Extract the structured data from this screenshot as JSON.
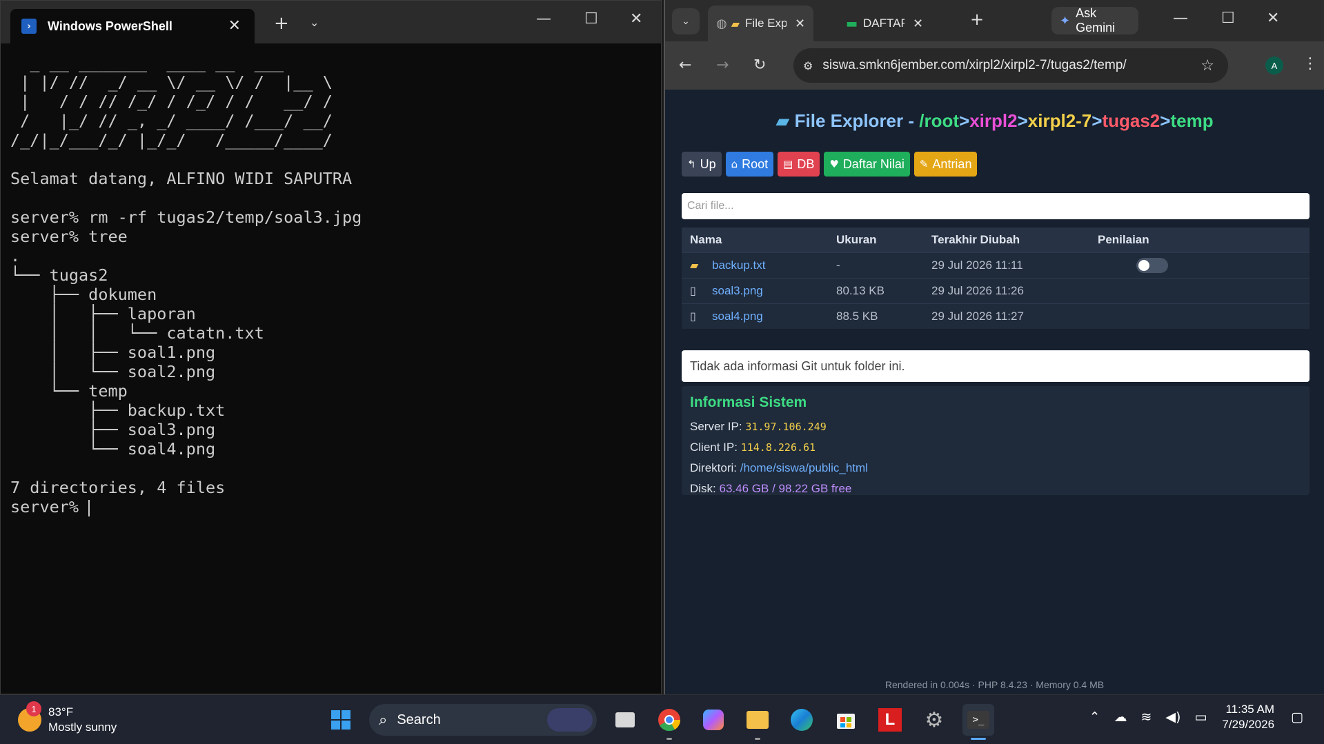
{
  "powershell": {
    "tab_title": "Windows PowerShell",
    "tab_icon": "powershell-icon",
    "terminal_lines": [
      "  _ __ _______  ____ __  ___",
      " | |/ //  _/ __ \\/ __ \\/ /  |__ \\",
      " |   / / // /_/ / /_/ / /   __/ /",
      " /   |_/ // _, _/ ____/ /___/ __/",
      "/_/|_/___/_/ |_/_/   /_____/____/",
      "",
      "Selamat datang, ALFINO WIDI SAPUTRA",
      "",
      "server% rm -rf tugas2/temp/soal3.jpg",
      "server% tree",
      ".",
      "└── tugas2",
      "    ├── dokumen",
      "    │   ├── laporan",
      "    │   │   └── catatn.txt",
      "    │   ├── soal1.png",
      "    │   └── soal2.png",
      "    └── temp",
      "        ├── backup.txt",
      "        ├── soal3.png",
      "        └── soal4.png",
      "",
      "7 directories, 4 files"
    ],
    "prompt": "server% "
  },
  "chrome": {
    "tabs": [
      {
        "label": "File Explorer",
        "icon": "folder-icon"
      },
      {
        "label": "DAFTAR HADIR",
        "icon": "sheets-icon"
      }
    ],
    "gemini_label": "Ask Gemini",
    "url": "siswa.smkn6jember.com/xirpl2/xirpl2-7/tugas2/temp/",
    "avatar_letter": "A"
  },
  "explorer": {
    "title_label": "File Explorer -",
    "path": [
      {
        "text": "/root",
        "color": "#3ddc84"
      },
      {
        "text": ">",
        "color": "#8ec5ff"
      },
      {
        "text": "xirpl2",
        "color": "#e94fd6"
      },
      {
        "text": ">",
        "color": "#8ec5ff"
      },
      {
        "text": "xirpl2-7",
        "color": "#f4d14a"
      },
      {
        "text": ">",
        "color": "#8ec5ff"
      },
      {
        "text": "tugas2",
        "color": "#ff5a6a"
      },
      {
        "text": ">",
        "color": "#8ec5ff"
      },
      {
        "text": "temp",
        "color": "#3ddc84"
      }
    ],
    "buttons": [
      {
        "label": "Up",
        "icon": "↰",
        "color": "#3a4456"
      },
      {
        "label": "Root",
        "icon": "⌂",
        "color": "#2f7be0"
      },
      {
        "label": "DB",
        "icon": "▤",
        "color": "#e0424f"
      },
      {
        "label": "Daftar Nilai",
        "icon": "♥",
        "color": "#1fae5b"
      },
      {
        "label": "Antrian",
        "icon": "✎",
        "color": "#e5a615"
      }
    ],
    "search_placeholder": "Cari file...",
    "columns": [
      "Nama",
      "Ukuran",
      "Terakhir Diubah",
      "Penilaian"
    ],
    "rows": [
      {
        "name": "backup.txt",
        "size": "-",
        "modified": "29 Jul 2026 11:11",
        "icon": "folder",
        "toggle": true
      },
      {
        "name": "soal3.png",
        "size": "80.13 KB",
        "modified": "29 Jul 2026 11:26",
        "icon": "file",
        "toggle": false
      },
      {
        "name": "soal4.png",
        "size": "88.5 KB",
        "modified": "29 Jul 2026 11:27",
        "icon": "file",
        "toggle": false
      }
    ],
    "git_info": "Tidak ada informasi Git untuk folder ini.",
    "system": {
      "title": "Informasi Sistem",
      "server_ip_label": "Server IP:",
      "server_ip": "31.97.106.249",
      "client_ip_label": "Client IP:",
      "client_ip": "114.8.226.61",
      "dir_label": "Direktori:",
      "dir": "/home/siswa/public_html",
      "disk_label": "Disk:",
      "disk": "63.46 GB / 98.22 GB free"
    },
    "footer": "Rendered in 0.004s · PHP 8.4.23 · Memory 0.4 MB"
  },
  "taskbar": {
    "weather_temp": "83°F",
    "weather_desc": "Mostly sunny",
    "weather_badge": "1",
    "search_label": "Search",
    "time": "11:35 AM",
    "date": "7/29/2026"
  }
}
